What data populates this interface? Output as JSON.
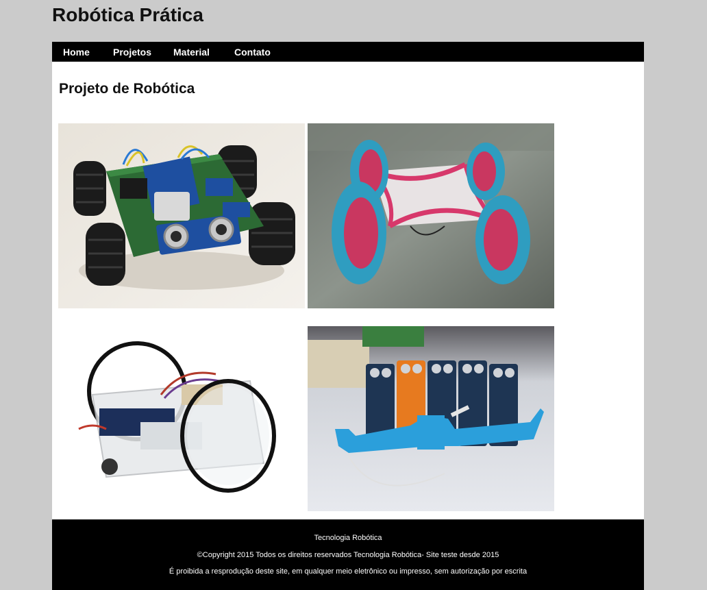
{
  "site": {
    "title": "Robótica Prática"
  },
  "nav": {
    "items": [
      "Home",
      "Projetos",
      "Material",
      "Contato"
    ]
  },
  "main": {
    "heading": "Projeto de Robótica",
    "gallery": [
      {
        "icon": "robot-car-photo"
      },
      {
        "icon": "quad-wheel-robot-photo"
      },
      {
        "icon": "acrylic-robot-photo"
      },
      {
        "icon": "battery-servo-photo"
      }
    ]
  },
  "footer": {
    "line1": "Tecnologia Robótica",
    "line2": "©Copyright 2015 Todos os direitos reservados Tecnologia Robótica- Site teste desde 2015",
    "line3": "É proibida a resprodução deste site, em qualquer meio eletrônico ou impresso, sem autorização por escrita"
  },
  "colors": {
    "page_bg": "#cbcbcb",
    "nav_bg": "#000000",
    "footer_bg": "#000000",
    "content_bg": "#ffffff"
  }
}
